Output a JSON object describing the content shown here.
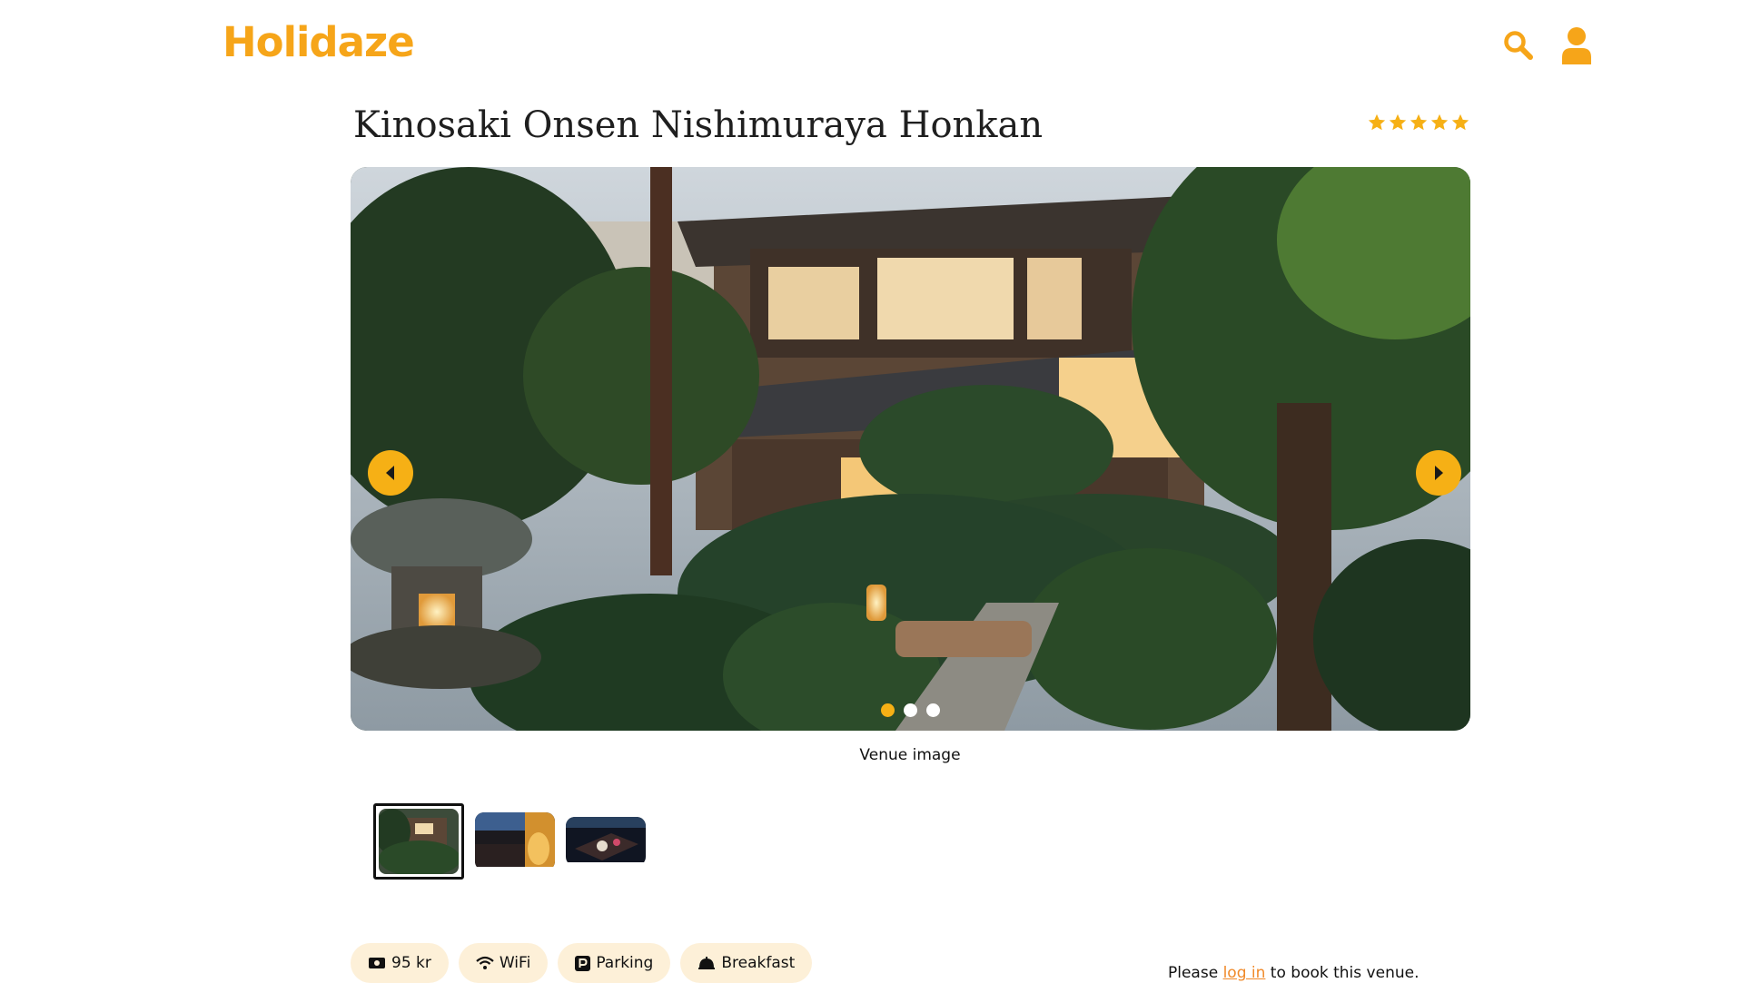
{
  "brand": {
    "logo": "Holidaze",
    "accent": "#f6a519"
  },
  "header": {
    "search_icon": "search-icon",
    "profile_icon": "user-icon"
  },
  "venue": {
    "name": "Kinosaki Onsen Nishimuraya Honkan",
    "rating": 5,
    "caption": "Venue image"
  },
  "carousel": {
    "slides": 3,
    "active": 1
  },
  "amenities": [
    {
      "icon": "money-icon",
      "label": "95 kr"
    },
    {
      "icon": "wifi-icon",
      "label": "WiFi"
    },
    {
      "icon": "parking-icon",
      "label": "Parking"
    },
    {
      "icon": "breakfast-icon",
      "label": "Breakfast"
    }
  ],
  "booking": {
    "prefix": "Please ",
    "link": "log in",
    "suffix": " to book this venue."
  }
}
